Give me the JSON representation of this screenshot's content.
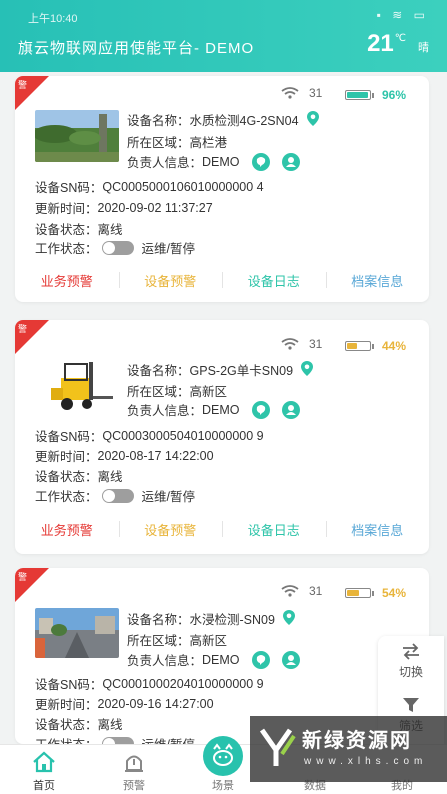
{
  "status_bar": {
    "time": "上午10:40",
    "icons": "▪ ≋ ▭"
  },
  "header": {
    "title": "旗云物联网应用使能平台- DEMO",
    "temperature": "21",
    "temp_unit": "℃",
    "weather": "晴"
  },
  "colors": {
    "primary": "#28c2ad",
    "alert_red": "#e53935",
    "warning_yellow": "#e8b43a",
    "link_teal": "#2ec4a9",
    "archive_blue": "#58a7d6"
  },
  "labels": {
    "device_name": "设备名称：",
    "region": "所在区域：",
    "owner": "负责人信息：",
    "sn": "设备SN码：",
    "updated": "更新时间：",
    "status": "设备状态：",
    "work_status": "工作状态：",
    "actions": [
      "业务预警",
      "设备预警",
      "设备日志",
      "档案信息"
    ]
  },
  "devices": [
    {
      "badge": "警",
      "signal": "31",
      "battery": "96%",
      "battery_level": 0.96,
      "battery_color": "#2ec4a9",
      "name": "水质检测4G-2SN04",
      "region": "高栏港",
      "owner": "DEMO",
      "sn": "QC0005000106010000000 4",
      "updated": "2020-09-02 11:37:27",
      "status": "离线",
      "work": "运维/暂停",
      "thumb": "landscape-photo"
    },
    {
      "badge": "警",
      "signal": "31",
      "battery": "44%",
      "battery_level": 0.44,
      "battery_color": "#e8b43a",
      "name": "GPS-2G单卡SN09",
      "region": "高新区",
      "owner": "DEMO",
      "sn": "QC0003000504010000000 9",
      "updated": "2020-08-17 14:22:00",
      "status": "离线",
      "work": "运维/暂停",
      "thumb": "forklift-image"
    },
    {
      "badge": "警",
      "signal": "31",
      "battery": "54%",
      "battery_level": 0.54,
      "battery_color": "#e8b43a",
      "name": "水浸检测-SN09",
      "region": "高新区",
      "owner": "DEMO",
      "sn": "QC0001000204010000000 9",
      "updated": "2020-09-16 14:27:00",
      "status": "离线",
      "work": "运维/暂停",
      "thumb": "street-photo"
    }
  ],
  "float_panel": {
    "switch": "切换",
    "filter": "筛选"
  },
  "bottom_nav": {
    "home": "首页",
    "warning": "预警",
    "center": "场景",
    "data": "数据",
    "mine": "我的"
  },
  "watermark": {
    "title": "新绿资源网",
    "url": "www.xlhs.com"
  }
}
